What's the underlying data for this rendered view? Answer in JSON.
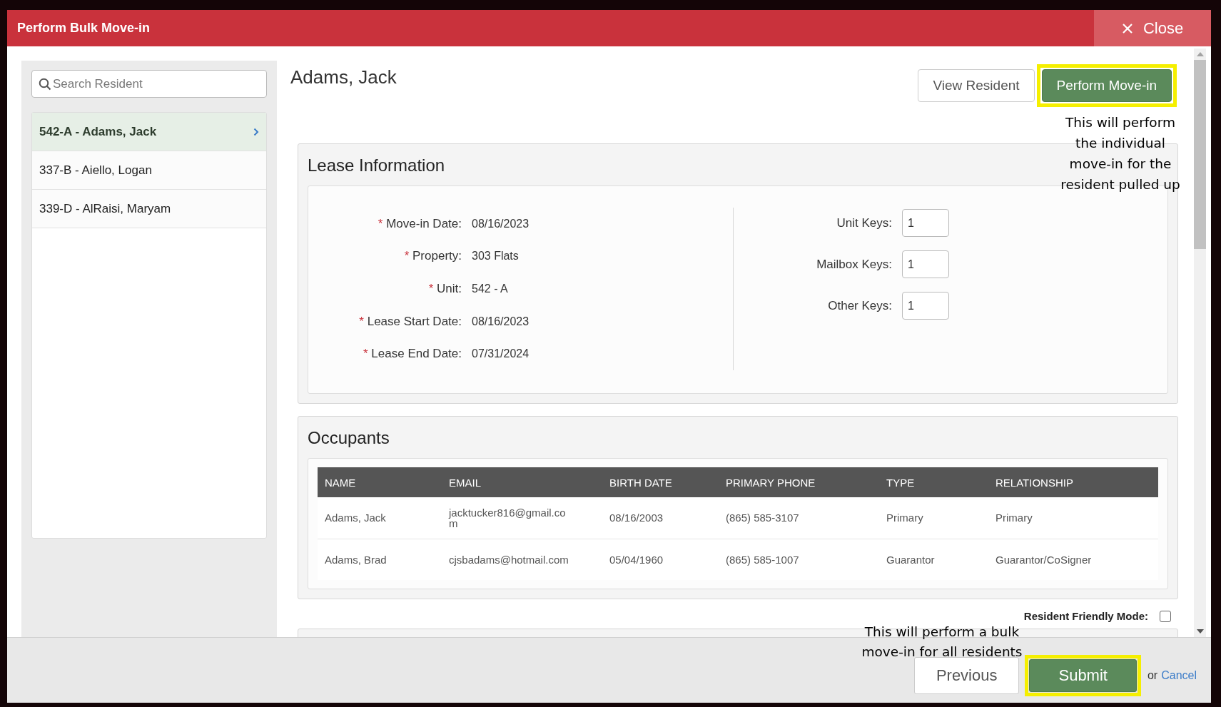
{
  "modal": {
    "title": "Perform Bulk Move-in",
    "close_label": "Close"
  },
  "sidebar": {
    "search": {
      "placeholder": "Search Resident"
    },
    "items": [
      {
        "label": "542-A - Adams, Jack",
        "selected": true
      },
      {
        "label": "337-B - Aiello, Logan",
        "selected": false
      },
      {
        "label": "339-D - AlRaisi, Maryam",
        "selected": false
      }
    ]
  },
  "resident": {
    "name": "Adams, Jack",
    "buttons": [
      {
        "label": "View Resident",
        "kind": "default",
        "highlighted": false
      },
      {
        "label": "Perform Move-in",
        "kind": "primary",
        "highlighted": true
      }
    ]
  },
  "lease": {
    "title": "Lease Information",
    "fields": [
      {
        "required_mark": "*",
        "label": "Move-in Date:",
        "value": "08/16/2023"
      },
      {
        "required_mark": "*",
        "label": "Property:",
        "value": "303 Flats"
      },
      {
        "required_mark": "*",
        "label": "Unit:",
        "value": "542 - A"
      },
      {
        "required_mark": "*",
        "label": "Lease Start Date:",
        "value": "08/16/2023"
      },
      {
        "required_mark": "*",
        "label": "Lease End Date:",
        "value": "07/31/2024"
      }
    ],
    "keys": [
      {
        "label": "Unit Keys:",
        "value": "1"
      },
      {
        "label": "Mailbox Keys:",
        "value": "1"
      },
      {
        "label": "Other Keys:",
        "value": "1"
      }
    ]
  },
  "occupants": {
    "title": "Occupants",
    "columns": [
      "NAME",
      "EMAIL",
      "BIRTH DATE",
      "PRIMARY PHONE",
      "TYPE",
      "RELATIONSHIP"
    ],
    "rows": [
      [
        "Adams, Jack",
        "jacktucker816@gmail.com",
        "08/16/2003",
        "(865) 585-3107",
        "Primary",
        "Primary"
      ],
      [
        "Adams, Brad",
        "cjsbadams@hotmail.com",
        "05/04/1960",
        "(865) 585-1007",
        "Guarantor",
        "Guarantor/CoSigner"
      ]
    ]
  },
  "resident_friendly_mode": {
    "label": "Resident Friendly Mode:",
    "checked": false
  },
  "footer": {
    "buttons": [
      {
        "label": "Previous",
        "kind": "default",
        "highlighted": false
      },
      {
        "label": "Submit",
        "kind": "primary",
        "highlighted": true
      }
    ],
    "or_text": "or",
    "cancel": "Cancel"
  },
  "annotations": [
    {
      "lines": [
        "This will perform",
        "the individual",
        "move-in for the",
        "resident pulled up"
      ]
    },
    {
      "lines": [
        "This will perform a bulk",
        "move-in for all residents"
      ]
    }
  ]
}
